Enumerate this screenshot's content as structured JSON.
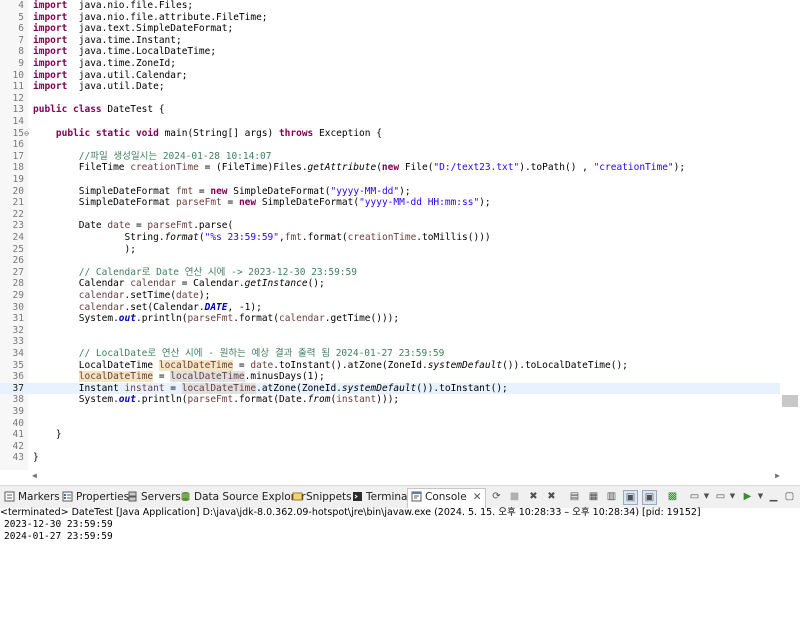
{
  "editor": {
    "lines": [
      {
        "n": "4",
        "segs": [
          [
            "kw",
            "import"
          ],
          [
            "",
            "  java.nio.file.Files;"
          ]
        ]
      },
      {
        "n": "5",
        "segs": [
          [
            "kw",
            "import"
          ],
          [
            "",
            "  java.nio.file.attribute.FileTime;"
          ]
        ]
      },
      {
        "n": "6",
        "segs": [
          [
            "kw",
            "import"
          ],
          [
            "",
            "  java.text.SimpleDateFormat;"
          ]
        ]
      },
      {
        "n": "7",
        "segs": [
          [
            "kw",
            "import"
          ],
          [
            "",
            "  java.time.Instant;"
          ]
        ]
      },
      {
        "n": "8",
        "segs": [
          [
            "kw",
            "import"
          ],
          [
            "",
            "  java.time.LocalDateTime;"
          ]
        ]
      },
      {
        "n": "9",
        "segs": [
          [
            "kw",
            "import"
          ],
          [
            "",
            "  java.time.ZoneId;"
          ]
        ]
      },
      {
        "n": "10",
        "segs": [
          [
            "kw",
            "import"
          ],
          [
            "",
            "  java.util.Calendar;"
          ]
        ]
      },
      {
        "n": "11",
        "segs": [
          [
            "kw",
            "import"
          ],
          [
            "",
            "  java.util.Date;"
          ]
        ]
      },
      {
        "n": "12",
        "segs": []
      },
      {
        "n": "13",
        "segs": [
          [
            "kw",
            "public class"
          ],
          [
            "",
            " DateTest {"
          ]
        ]
      },
      {
        "n": "14",
        "segs": []
      },
      {
        "n": "15",
        "fold": "⊖",
        "segs": [
          [
            "",
            "    "
          ],
          [
            "kw",
            "public static void"
          ],
          [
            "",
            " main(String[] args) "
          ],
          [
            "kw",
            "throws"
          ],
          [
            "",
            " Exception {"
          ]
        ]
      },
      {
        "n": "16",
        "segs": []
      },
      {
        "n": "17",
        "segs": [
          [
            "",
            "        "
          ],
          [
            "cmt",
            "//파일 생성일시는 2024-01-28 10:14:07"
          ]
        ]
      },
      {
        "n": "18",
        "segs": [
          [
            "",
            "        FileTime "
          ],
          [
            "loc",
            "creationTime"
          ],
          [
            "",
            " = (FileTime)Files."
          ],
          [
            "it",
            "getAttribute"
          ],
          [
            "",
            "("
          ],
          [
            "kw",
            "new"
          ],
          [
            "",
            " File("
          ],
          [
            "str",
            "\"D:/text23.txt\""
          ],
          [
            "",
            ").toPath() , "
          ],
          [
            "str",
            "\"creationTime\""
          ],
          [
            "",
            ");"
          ]
        ]
      },
      {
        "n": "19",
        "segs": []
      },
      {
        "n": "20",
        "segs": [
          [
            "",
            "        SimpleDateFormat "
          ],
          [
            "loc",
            "fmt"
          ],
          [
            "",
            " = "
          ],
          [
            "kw",
            "new"
          ],
          [
            "",
            " SimpleDateFormat("
          ],
          [
            "str",
            "\"yyyy-MM-dd\""
          ],
          [
            "",
            ");"
          ]
        ]
      },
      {
        "n": "21",
        "segs": [
          [
            "",
            "        SimpleDateFormat "
          ],
          [
            "loc",
            "parseFmt"
          ],
          [
            "",
            " = "
          ],
          [
            "kw",
            "new"
          ],
          [
            "",
            " SimpleDateFormat("
          ],
          [
            "str",
            "\"yyyy-MM-dd HH:mm:ss\""
          ],
          [
            "",
            ");"
          ]
        ]
      },
      {
        "n": "22",
        "segs": []
      },
      {
        "n": "23",
        "segs": [
          [
            "",
            "        Date "
          ],
          [
            "loc",
            "date"
          ],
          [
            "",
            " = "
          ],
          [
            "loc",
            "parseFmt"
          ],
          [
            "",
            ".parse("
          ]
        ]
      },
      {
        "n": "24",
        "segs": [
          [
            "",
            "                String."
          ],
          [
            "it",
            "format"
          ],
          [
            "",
            "("
          ],
          [
            "str",
            "\"%s 23:59:59\""
          ],
          [
            "",
            ","
          ],
          [
            "loc",
            "fmt"
          ],
          [
            "",
            ".format("
          ],
          [
            "loc",
            "creationTime"
          ],
          [
            "",
            ".toMillis()))"
          ]
        ]
      },
      {
        "n": "25",
        "segs": [
          [
            "",
            "                );"
          ]
        ]
      },
      {
        "n": "26",
        "segs": []
      },
      {
        "n": "27",
        "segs": [
          [
            "",
            "        "
          ],
          [
            "cmt",
            "// Calendar로 Date 연산 시에 -> 2023-12-30 23:59:59"
          ]
        ]
      },
      {
        "n": "28",
        "segs": [
          [
            "",
            "        Calendar "
          ],
          [
            "loc",
            "calendar"
          ],
          [
            "",
            " = Calendar."
          ],
          [
            "it",
            "getInstance"
          ],
          [
            "",
            "();"
          ]
        ]
      },
      {
        "n": "29",
        "segs": [
          [
            "",
            "        "
          ],
          [
            "loc",
            "calendar"
          ],
          [
            "",
            ".setTime("
          ],
          [
            "loc",
            "date"
          ],
          [
            "",
            ");"
          ]
        ]
      },
      {
        "n": "30",
        "segs": [
          [
            "",
            "        "
          ],
          [
            "loc",
            "calendar"
          ],
          [
            "",
            ".set(Calendar."
          ],
          [
            "fldit",
            "DATE"
          ],
          [
            "",
            ", -1);"
          ]
        ]
      },
      {
        "n": "31",
        "segs": [
          [
            "",
            "        System."
          ],
          [
            "fldit",
            "out"
          ],
          [
            "",
            ".println("
          ],
          [
            "loc",
            "parseFmt"
          ],
          [
            "",
            ".format("
          ],
          [
            "loc",
            "calendar"
          ],
          [
            "",
            ".getTime()));"
          ]
        ]
      },
      {
        "n": "32",
        "segs": []
      },
      {
        "n": "33",
        "segs": []
      },
      {
        "n": "34",
        "segs": [
          [
            "",
            "        "
          ],
          [
            "cmt",
            "// LocalDate로 연산 시에 - 원하는 예상 결과 출력 됨 2024-01-27 23:59:59"
          ]
        ]
      },
      {
        "n": "35",
        "segs": [
          [
            "",
            "        LocalDateTime "
          ],
          [
            "loc hl",
            "localDateTime"
          ],
          [
            "",
            " = "
          ],
          [
            "loc",
            "date"
          ],
          [
            "",
            ".toInstant().atZone(ZoneId."
          ],
          [
            "it",
            "systemDefault"
          ],
          [
            "",
            "()).toLocalDateTime();"
          ]
        ]
      },
      {
        "n": "36",
        "segs": [
          [
            "",
            "        "
          ],
          [
            "loc hl",
            "localDateTime"
          ],
          [
            "",
            " = "
          ],
          [
            "loc hlg",
            "localDateTime"
          ],
          [
            "",
            ".minusDays(1);"
          ]
        ]
      },
      {
        "n": "37",
        "current": true,
        "segs": [
          [
            "",
            "        Instant "
          ],
          [
            "loc",
            "instant"
          ],
          [
            "",
            " = "
          ],
          [
            "loc hlg",
            "loca"
          ],
          [
            "caret",
            ""
          ],
          [
            "loc hlg",
            "lDateTime"
          ],
          [
            "",
            ".atZone(ZoneId."
          ],
          [
            "it",
            "systemDefault"
          ],
          [
            "",
            "()).toInstant();"
          ]
        ]
      },
      {
        "n": "38",
        "segs": [
          [
            "",
            "        System."
          ],
          [
            "fldit",
            "out"
          ],
          [
            "",
            ".println("
          ],
          [
            "loc",
            "parseFmt"
          ],
          [
            "",
            ".format(Date."
          ],
          [
            "it",
            "from"
          ],
          [
            "",
            "("
          ],
          [
            "loc",
            "instant"
          ],
          [
            "",
            ")));"
          ]
        ]
      },
      {
        "n": "39",
        "segs": []
      },
      {
        "n": "40",
        "segs": []
      },
      {
        "n": "41",
        "segs": [
          [
            "",
            "    }"
          ]
        ]
      },
      {
        "n": "42",
        "segs": []
      },
      {
        "n": "43",
        "segs": [
          [
            "",
            "}"
          ]
        ]
      }
    ]
  },
  "tabs": {
    "markers": "Markers",
    "properties": "Properties",
    "servers": "Servers",
    "data_source_explorer": "Data Source Explorer",
    "snippets": "Snippets",
    "terminal": "Terminal",
    "console": "Console"
  },
  "console": {
    "header": "<terminated> DateTest [Java Application] D:\\java\\jdk-8.0.362.09-hotspot\\jre\\bin\\javaw.exe  (2024. 5. 15. 오후 10:28:33 – 오후 10:28:34) [pid: 19152]",
    "output": [
      "2023-12-30 23:59:59",
      "2024-01-27 23:59:59"
    ]
  },
  "colors": {
    "keyword": "#7f0055",
    "string": "#2a00ff",
    "comment": "#3f7f5f",
    "current_line": "#e8f2fe",
    "occurrence": "#f4e6c3"
  }
}
